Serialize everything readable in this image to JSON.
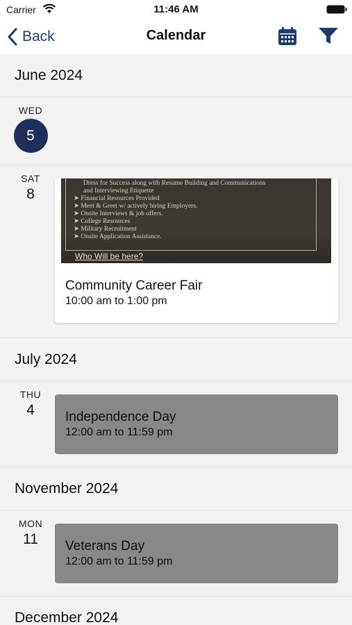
{
  "status_bar": {
    "carrier": "Carrier",
    "time": "11:46 AM"
  },
  "nav": {
    "back_label": "Back",
    "title": "Calendar",
    "accent": "#1f3a6e"
  },
  "months": [
    {
      "label": "June 2024"
    },
    {
      "label": "July 2024"
    },
    {
      "label": "November 2024"
    },
    {
      "label": "December 2024"
    }
  ],
  "days": {
    "jun5": {
      "dow": "WED",
      "num": "5"
    },
    "jun8": {
      "dow": "SAT",
      "num": "8"
    },
    "jul4": {
      "dow": "THU",
      "num": "4"
    },
    "nov11": {
      "dow": "MON",
      "num": "11"
    }
  },
  "events": {
    "career_fair": {
      "title": "Community Career Fair",
      "time": "10:00 am to 1:00 pm",
      "flyer_lines": [
        "Dress for Success along with Resume Building and Communications",
        "and Interviewing Etiquette",
        "Financial Resources Provided",
        "Meet & Greet w/ actively hiring Employers.",
        "Onsite Interviews & job offers.",
        "College Resources",
        "Military Recruitment",
        "Onsite Application Assistance."
      ],
      "flyer_footer": "Who Will be here?"
    },
    "independence_day": {
      "title": "Independence Day",
      "time": "12:00 am to 11:59 pm"
    },
    "veterans_day": {
      "title": "Veterans Day",
      "time": "12:00 am to 11:59 pm"
    }
  }
}
